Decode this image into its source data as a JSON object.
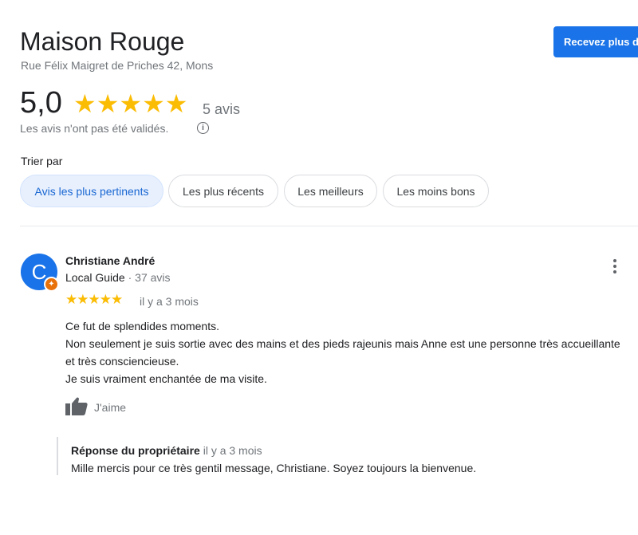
{
  "business": {
    "name": "Maison Rouge",
    "address": "Rue Félix Maigret de Priches 42, Mons",
    "cta_label": "Recevez plus d'avis"
  },
  "rating": {
    "score": "5,0",
    "stars": "★★★★★",
    "value": 5,
    "count_label": "5 avis",
    "disclaimer": "Les avis n'ont pas été validés.",
    "info_glyph": "i"
  },
  "sort": {
    "label": "Trier par",
    "chips": [
      {
        "label": "Avis les plus pertinents",
        "active": true
      },
      {
        "label": "Les plus récents",
        "active": false
      },
      {
        "label": "Les meilleurs",
        "active": false
      },
      {
        "label": "Les moins bons",
        "active": false
      }
    ]
  },
  "review": {
    "avatar_initial": "C",
    "badge_glyph": "✦",
    "reviewer_name": "Christiane André",
    "local_guide": "Local Guide",
    "reviews_count": " · 37 avis",
    "stars": "★★★★★",
    "rating": 5,
    "time": "il y a 3 mois",
    "lines": [
      "Ce fut de splendides moments.",
      "Non seulement je suis sortie avec des mains et des pieds rajeunis mais Anne est une personne très accueillante et très consciencieuse.",
      "Je suis vraiment enchantée de ma visite."
    ],
    "like_label": "J'aime",
    "reply": {
      "owner_label": "Réponse du propriétaire",
      "time": " il y a 3 mois",
      "text": "Mille mercis pour ce très gentil message, Christiane. Soyez toujours la bienvenue."
    }
  },
  "icons": {
    "info": "info-icon",
    "more": "more-vert-icon",
    "like": "thumbs-up-icon",
    "badge": "local-guide-badge-icon"
  },
  "colors": {
    "accent": "#1a73e8",
    "star": "#fbbc04",
    "badge": "#e8710a",
    "chip_active_bg": "#e8f0fe"
  }
}
